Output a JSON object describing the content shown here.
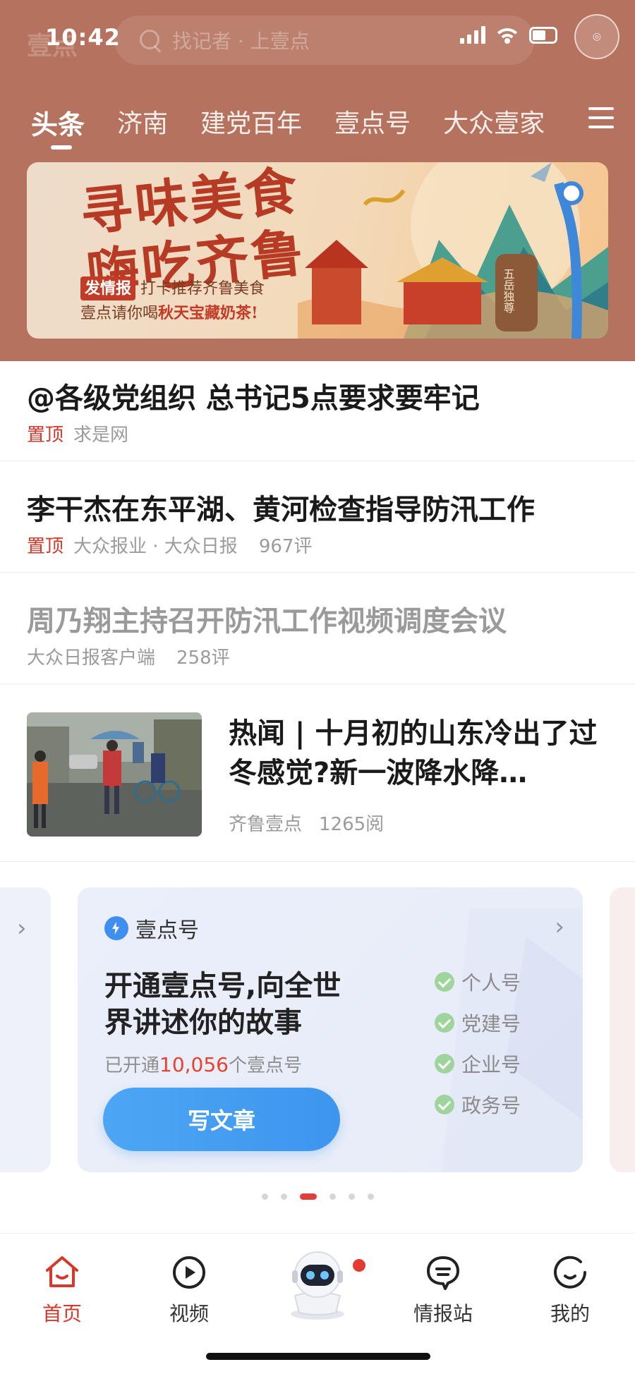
{
  "status_bar": {
    "time": "10:42"
  },
  "header": {
    "logo": "壹点",
    "search_placeholder": "找记者 · 上壹点",
    "tabs": [
      {
        "label": "头条",
        "active": true
      },
      {
        "label": "济南"
      },
      {
        "label": "建党百年"
      },
      {
        "label": "壹点号"
      },
      {
        "label": "大众壹家"
      }
    ]
  },
  "banner": {
    "title_line1": "寻味美食",
    "title_line2": "嗨吃齐鲁",
    "tag": "发情报",
    "sub1": "打卡推荐齐鲁美食",
    "sub2_prefix": "壹点请你喝",
    "sub2_highlight": "秋天宝藏奶茶",
    "sub2_suffix": "!",
    "art_text": "五岳独尊"
  },
  "news": [
    {
      "title": "@各级党组织 总书记5点要求要牢记",
      "pin": "置顶",
      "source": "求是网",
      "count": ""
    },
    {
      "title": "李干杰在东平湖、黄河检查指导防汛工作",
      "pin": "置顶",
      "source": "大众报业 · 大众日报",
      "count": "967评"
    },
    {
      "title": "周乃翔主持召开防汛工作视频调度会议",
      "pin": "",
      "source": "大众日报客户端",
      "count": "258评",
      "read": true
    }
  ],
  "hot": {
    "title": "热闻 | 十月初的山东冷出了过冬感觉?新一波降水降…",
    "source": "齐鲁壹点",
    "count": "1265阅"
  },
  "card": {
    "badge": "壹点号",
    "title": "开通壹点号,向全世界讲述你的故事",
    "stat_prefix": "已开通",
    "stat_number": "10,056",
    "stat_suffix": "个壹点号",
    "button": "写文章",
    "types": [
      "个人号",
      "党建号",
      "企业号",
      "政务号"
    ]
  },
  "carousel": {
    "count": 6,
    "active_index": 2
  },
  "bottom_nav": [
    {
      "label": "首页",
      "icon": "home-icon",
      "active": true
    },
    {
      "label": "视频",
      "icon": "play-icon"
    },
    {
      "label": "情报站",
      "icon": "chat-icon"
    },
    {
      "label": "我的",
      "icon": "profile-icon"
    }
  ],
  "colors": {
    "header_bg": "#b5725e",
    "accent_red": "#d5392b",
    "button_blue": "#3e95ee"
  }
}
